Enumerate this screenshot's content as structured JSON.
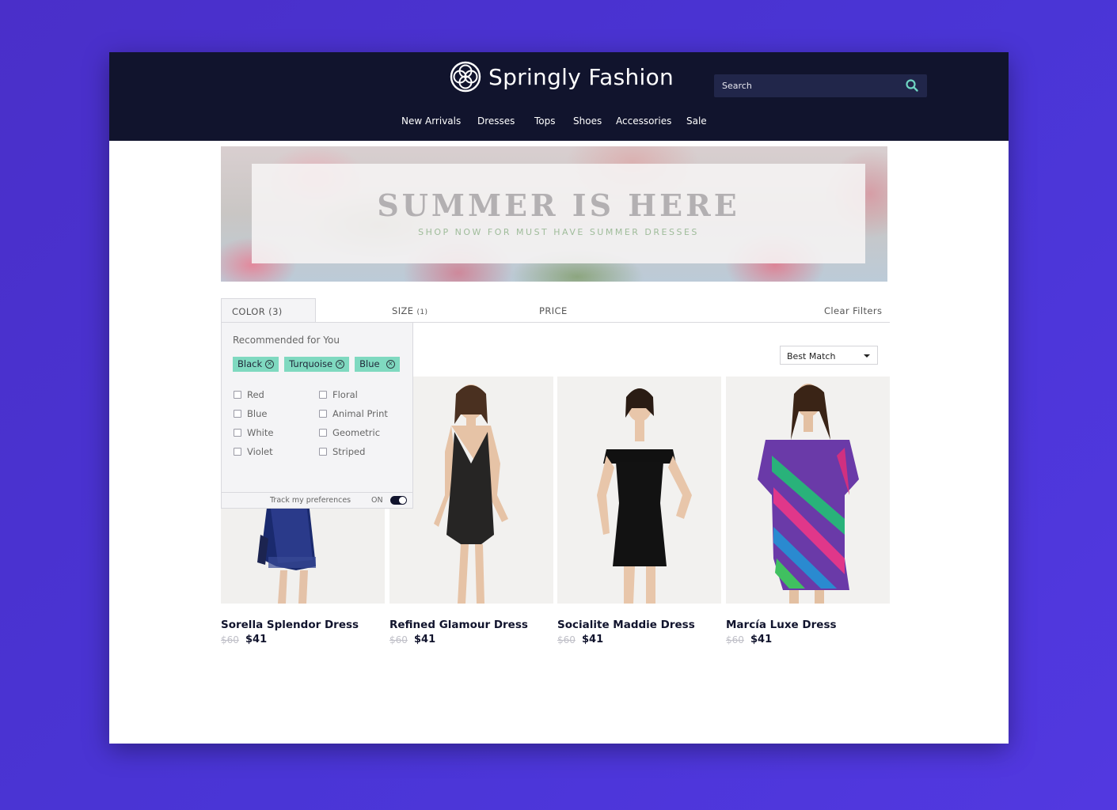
{
  "brand": {
    "name": "Springly Fashion"
  },
  "search": {
    "placeholder": "Search"
  },
  "nav": {
    "items": [
      "New Arrivals",
      "Dresses",
      "Tops",
      "Shoes",
      "Accessories",
      "Sale"
    ]
  },
  "banner": {
    "title": "SUMMER IS HERE",
    "subtitle": "SHOP NOW FOR MUST HAVE SUMMER DRESSES"
  },
  "filters": {
    "color_label": "COLOR (3)",
    "size_label": "SIZE",
    "size_count": "(1)",
    "price_label": "PRICE",
    "clear_label": "Clear Filters"
  },
  "color_dropdown": {
    "recommended_title": "Recommended for You",
    "chips": [
      "Black",
      "Turquoise",
      "Blue"
    ],
    "options_left": [
      "Red",
      "Blue",
      "White",
      "Violet"
    ],
    "options_right": [
      "Floral",
      "Animal Print",
      "Geometric",
      "Striped"
    ],
    "track_label": "Track my preferences",
    "track_state": "ON"
  },
  "sort": {
    "selected": "Best Match"
  },
  "colors": {
    "header_bg": "#11142d",
    "chip_bg": "#7fd9c0",
    "accent": "#6fd4c2",
    "page_bg": "#4a35d6"
  },
  "products": [
    {
      "name": "Sorella Splendor Dress",
      "old_price": "$60",
      "price": "$41"
    },
    {
      "name": "Refined Glamour Dress",
      "old_price": "$60",
      "price": "$41"
    },
    {
      "name": "Socialite Maddie Dress",
      "old_price": "$60",
      "price": "$41"
    },
    {
      "name": "Marcía Luxe Dress",
      "old_price": "$60",
      "price": "$41"
    }
  ]
}
